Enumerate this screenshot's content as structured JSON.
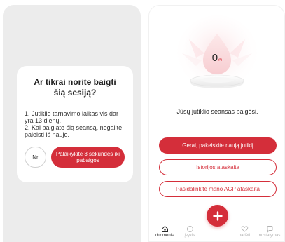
{
  "dialog": {
    "title": "Ar tikrai norite baigti šią sesiją?",
    "line1": "1. Jutiklio tarnavimo laikas vis dar yra 13 dienų.",
    "line2": "2. Kai baigiate šią seansą, negalite paleisti iš naujo.",
    "no_label": "Nr",
    "hold_label": "Palaikykite 3 sekundes iki pabaigos"
  },
  "session": {
    "percent_value": "0",
    "percent_unit": "%",
    "ended_message": "Jūsų jutiklio seansas baigėsi."
  },
  "actions": {
    "replace_sensor": "Gerai, pakeiskite naują jutiklį",
    "history_report": "Istorijos ataskaita",
    "share_agp": "Pasidalinkite mano AGP ataskaita"
  },
  "nav": {
    "home": "duomenis",
    "events": "įvykis",
    "help": "padėti",
    "settings": "nustatymas"
  },
  "colors": {
    "accent": "#d42e3a",
    "panel_bg": "#ececec"
  },
  "icons": {
    "home": "home-icon",
    "events": "clock-icon",
    "add": "plus-icon",
    "help": "heart-icon",
    "settings": "chat-icon"
  }
}
